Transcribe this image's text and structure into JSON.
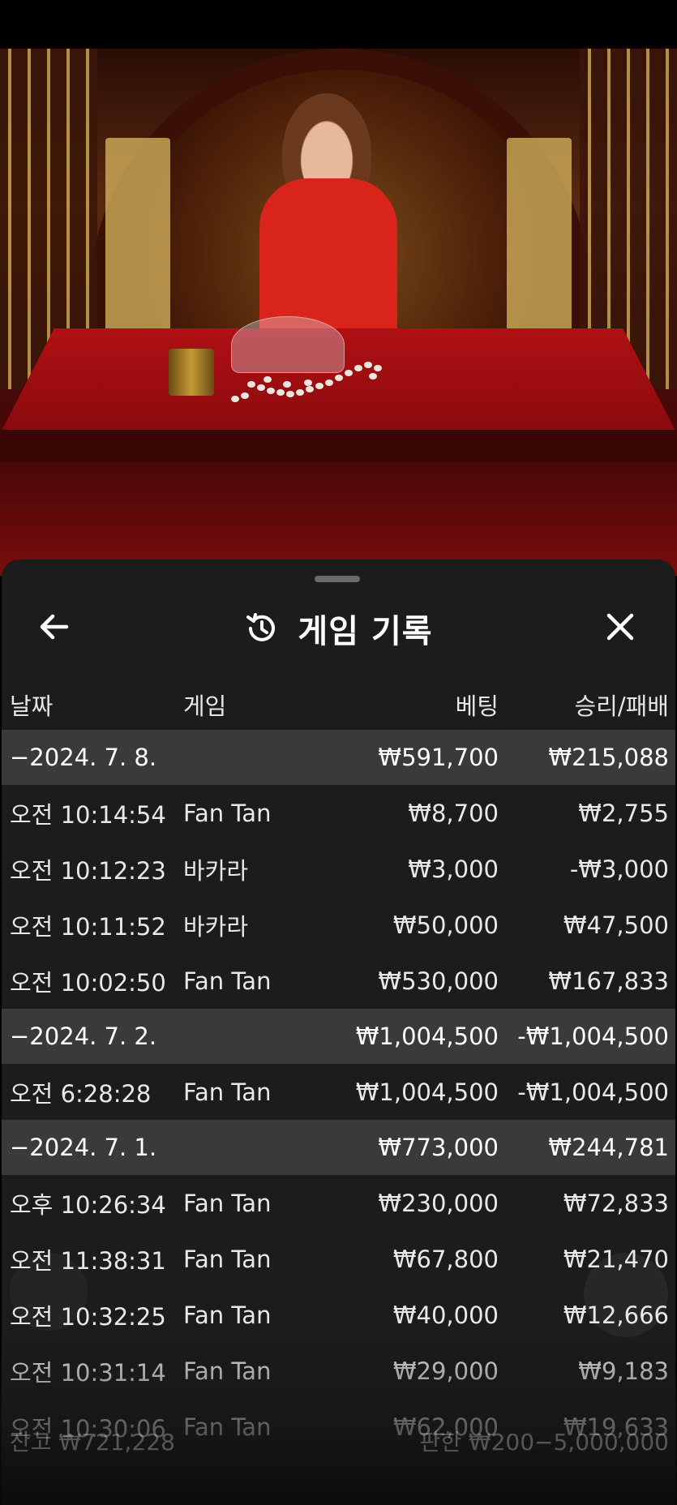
{
  "sheet": {
    "title": "게임 기록",
    "icons": {
      "back": "arrow-left-icon",
      "history": "history-icon",
      "close": "close-icon"
    }
  },
  "columns": {
    "date": "날짜",
    "game": "게임",
    "bet": "베팅",
    "win": "승리/패배"
  },
  "groups": [
    {
      "date": "−2024. 7. 8.",
      "bet": "₩591,700",
      "win": "₩215,088",
      "rows": [
        {
          "time": "오전 10:14:54",
          "game": "Fan Tan",
          "bet": "₩8,700",
          "win": "₩2,755"
        },
        {
          "time": "오전 10:12:23",
          "game": "바카라",
          "bet": "₩3,000",
          "win": "-₩3,000"
        },
        {
          "time": "오전 10:11:52",
          "game": "바카라",
          "bet": "₩50,000",
          "win": "₩47,500"
        },
        {
          "time": "오전 10:02:50",
          "game": "Fan Tan",
          "bet": "₩530,000",
          "win": "₩167,833"
        }
      ]
    },
    {
      "date": "−2024. 7. 2.",
      "bet": "₩1,004,500",
      "win": "-₩1,004,500",
      "rows": [
        {
          "time": "오전 6:28:28",
          "game": "Fan Tan",
          "bet": "₩1,004,500",
          "win": "-₩1,004,500"
        }
      ]
    },
    {
      "date": "−2024. 7. 1.",
      "bet": "₩773,000",
      "win": "₩244,781",
      "rows": [
        {
          "time": "오후 10:26:34",
          "game": "Fan Tan",
          "bet": "₩230,000",
          "win": "₩72,833"
        },
        {
          "time": "오전 11:38:31",
          "game": "Fan Tan",
          "bet": "₩67,800",
          "win": "₩21,470"
        },
        {
          "time": "오전 10:32:25",
          "game": "Fan Tan",
          "bet": "₩40,000",
          "win": "₩12,666"
        },
        {
          "time": "오전 10:31:14",
          "game": "Fan Tan",
          "bet": "₩29,000",
          "win": "₩9,183"
        },
        {
          "time": "오전 10:30:06",
          "game": "Fan Tan",
          "bet": "₩62,000",
          "win": "₩19,633"
        }
      ]
    }
  ],
  "underlay": {
    "balance": "잔고 ₩721,228",
    "limits": "판한 ₩200−5,000,000"
  },
  "colors": {
    "sheet_bg": "#1c1c1c",
    "group_bg": "#3a3a3a",
    "text": "#e8e8e8"
  }
}
